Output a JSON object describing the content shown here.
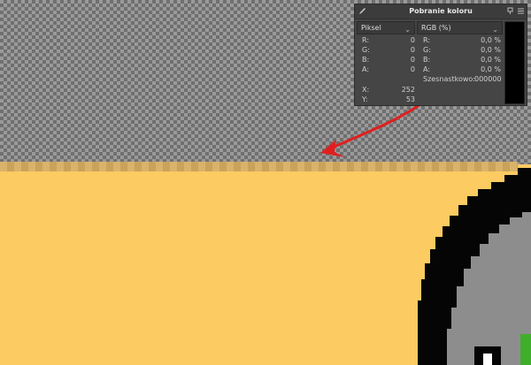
{
  "dialog": {
    "title": "Pobranie koloru",
    "icons": {
      "tool": "eyedropper-icon",
      "pin": "pin-icon",
      "menu": "menu-icon"
    },
    "left_mode": "Piksel",
    "right_mode": "RGB (%)",
    "pixel_values": [
      {
        "label": "R:",
        "value": "0"
      },
      {
        "label": "G:",
        "value": "0"
      },
      {
        "label": "B:",
        "value": "0"
      },
      {
        "label": "A:",
        "value": "0"
      }
    ],
    "percent_values": [
      {
        "label": "R:",
        "value": "0,0 %"
      },
      {
        "label": "G:",
        "value": "0,0 %"
      },
      {
        "label": "B:",
        "value": "0,0 %"
      },
      {
        "label": "A:",
        "value": "0,0 %"
      }
    ],
    "hex_label": "Szesnastkowo:",
    "hex_value": "000000",
    "x_label": "X:",
    "x_value": "252",
    "y_label": "Y:",
    "y_value": "53",
    "swatch_color": "#000000"
  },
  "colors": {
    "canvas_fill": "#fccb62",
    "outline": "#050505",
    "arrow": "#e01f1f",
    "accent_green": "#3fae2a"
  }
}
